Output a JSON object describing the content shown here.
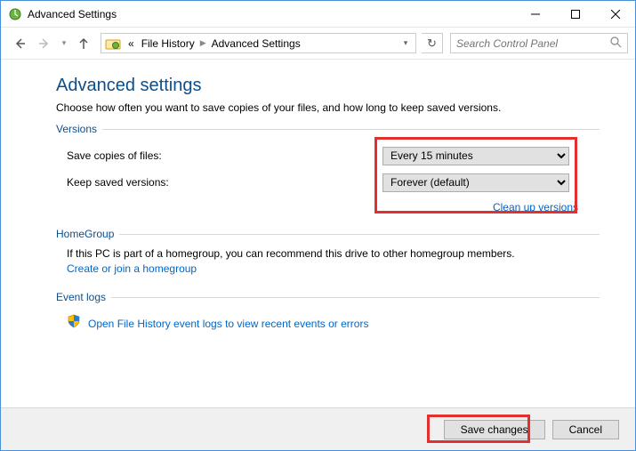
{
  "window": {
    "title": "Advanced Settings"
  },
  "nav": {
    "breadcrumb_prefix": "«",
    "crumb1": "File History",
    "crumb2": "Advanced Settings",
    "search_placeholder": "Search Control Panel"
  },
  "page": {
    "heading": "Advanced settings",
    "subtext": "Choose how often you want to save copies of your files, and how long to keep saved versions."
  },
  "versions_group": {
    "title": "Versions",
    "save_copies_label": "Save copies of files:",
    "save_copies_value": "Every 15 minutes",
    "keep_versions_label": "Keep saved versions:",
    "keep_versions_value": "Forever (default)",
    "cleanup_link": "Clean up versions"
  },
  "homegroup_group": {
    "title": "HomeGroup",
    "text": "If this PC is part of a homegroup, you can recommend this drive to other homegroup members.",
    "link": "Create or join a homegroup"
  },
  "eventlogs_group": {
    "title": "Event logs",
    "link": "Open File History event logs to view recent events or errors"
  },
  "footer": {
    "save_label": "Save changes",
    "cancel_label": "Cancel"
  }
}
